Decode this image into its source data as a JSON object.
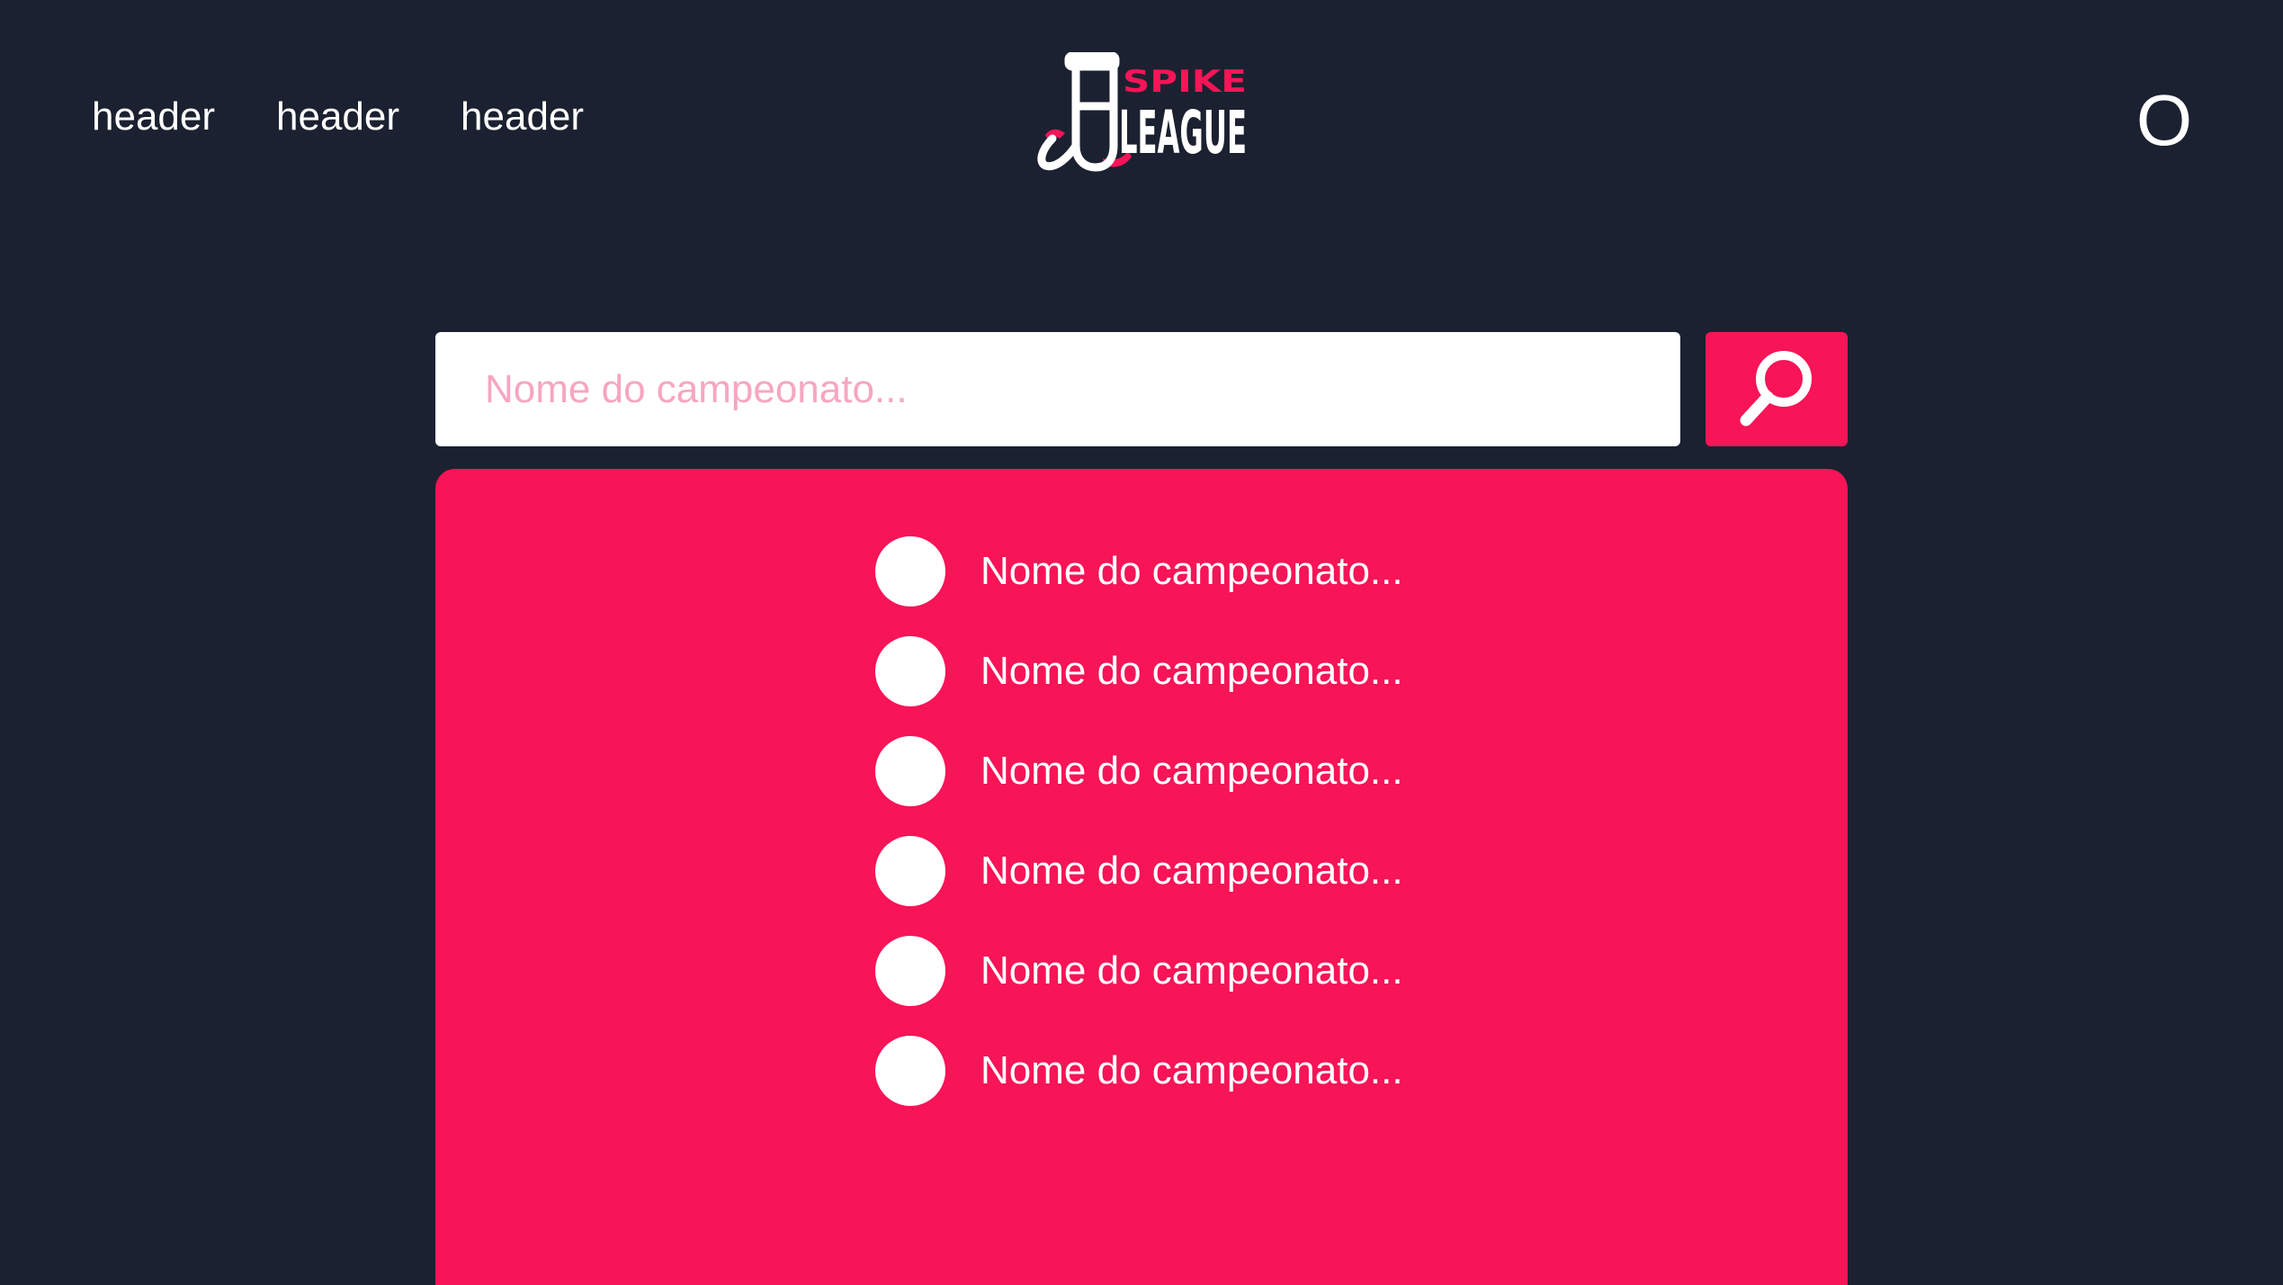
{
  "header": {
    "nav_links": [
      "header",
      "header",
      "header"
    ],
    "logo": {
      "top_text": "SPIKE",
      "bottom_text": "LEAGUE",
      "icon": "trophy-logo-icon"
    },
    "user_icon": "user-circle-icon",
    "user_glyph": "O"
  },
  "search": {
    "placeholder": "Nome do campeonato...",
    "value": "",
    "button_icon": "search-icon"
  },
  "results": {
    "items": [
      {
        "label": "Nome do campeonato..."
      },
      {
        "label": "Nome do campeonato..."
      },
      {
        "label": "Nome do campeonato..."
      },
      {
        "label": "Nome do campeonato..."
      },
      {
        "label": "Nome do campeonato..."
      },
      {
        "label": "Nome do campeonato..."
      }
    ]
  },
  "colors": {
    "background": "#1b2130",
    "accent": "#f71457",
    "text": "#ffffff",
    "placeholder": "#f7a6c0"
  }
}
